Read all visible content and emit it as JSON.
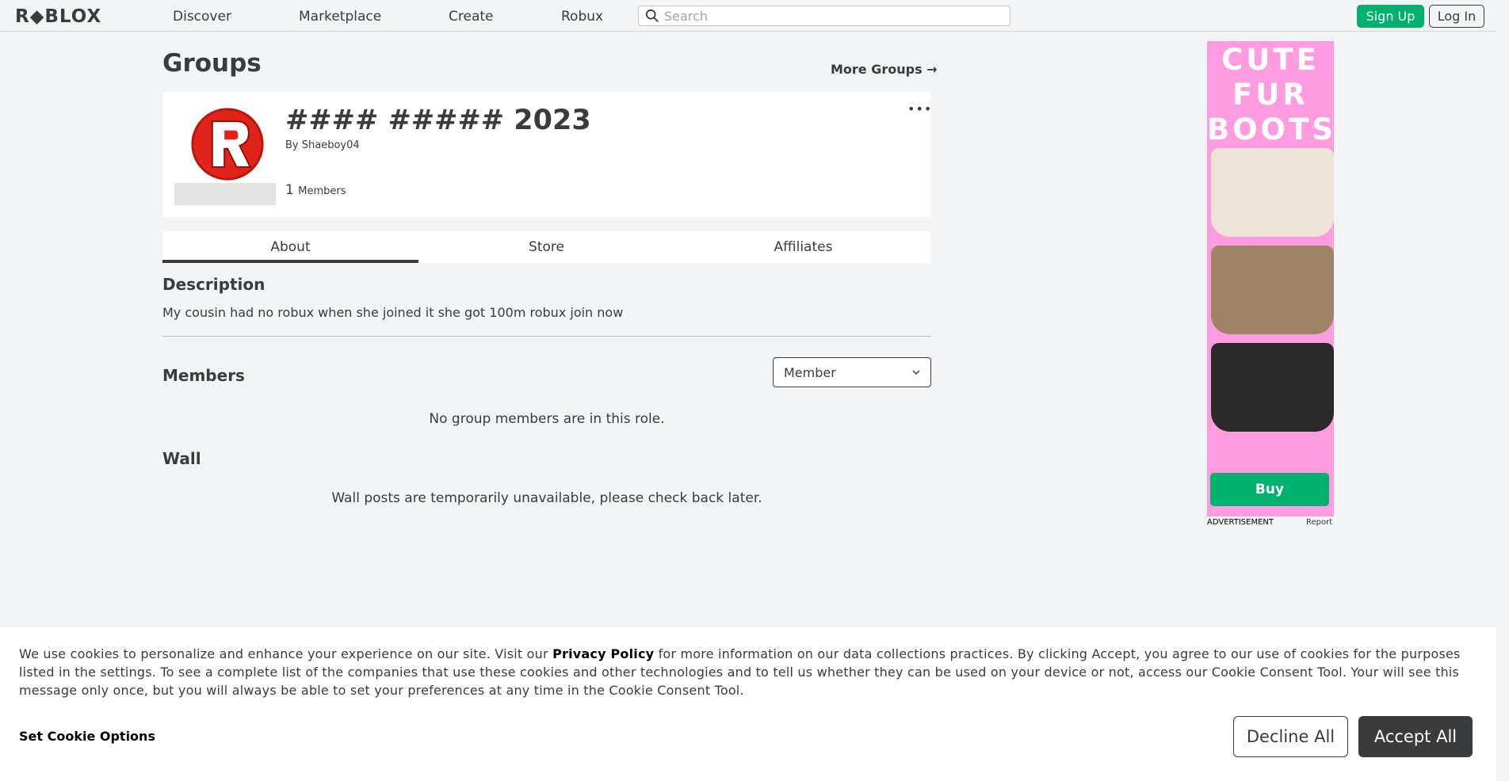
{
  "nav": {
    "logo": "R◆BLOX",
    "links": [
      "Discover",
      "Marketplace",
      "Create",
      "Robux"
    ],
    "search_placeholder": "Search",
    "signup_label": "Sign Up",
    "login_label": "Log In"
  },
  "page": {
    "title": "Groups",
    "more_groups_label": "More Groups →"
  },
  "group": {
    "name": "#### ##### 2023",
    "by_prefix": "By",
    "owner": "Shaeboy04",
    "member_count": "1",
    "member_label": "Members",
    "more_icon": "•••"
  },
  "tabs": [
    "About",
    "Store",
    "Affiliates"
  ],
  "about": {
    "description_title": "Description",
    "description_text": "My cousin had no robux when she joined it she got 100m robux join now",
    "members_title": "Members",
    "role_selected": "Member",
    "members_empty": "No group members are in this role.",
    "wall_title": "Wall",
    "wall_empty": "Wall posts are temporarily unavailable, please check back later."
  },
  "ad": {
    "headline": [
      "CUTE",
      "FUR",
      "BOOTS"
    ],
    "buy_label": "Buy",
    "label": "ADVERTISEMENT",
    "report_label": "Report",
    "colors": {
      "background": "#ff9ce0",
      "boot1": "#ece4d6",
      "boot2": "#9d8466",
      "boot3": "#2a2a2a"
    }
  },
  "cookie": {
    "text_before": "We use cookies to personalize and enhance your experience on our site. Visit our ",
    "link_label": "Privacy Policy",
    "text_after": " for more information on our data collections practices. By clicking Accept, you agree to our use of cookies for the purposes listed in the settings. To see a complete list of the companies that use these cookies and other technologies and to tell us whether they can be used on your device or not, access our Cookie Consent Tool. Your will see this message only once, but you will always be able to set your preferences at any time in the Cookie Consent Tool.",
    "set_options_label": "Set Cookie Options",
    "decline_label": "Decline All",
    "accept_label": "Accept All"
  },
  "colors": {
    "brand_green": "#00b06f",
    "text_dark": "#393b3d",
    "page_bg": "#f2f4f5",
    "logo_red": "#e2231a"
  }
}
